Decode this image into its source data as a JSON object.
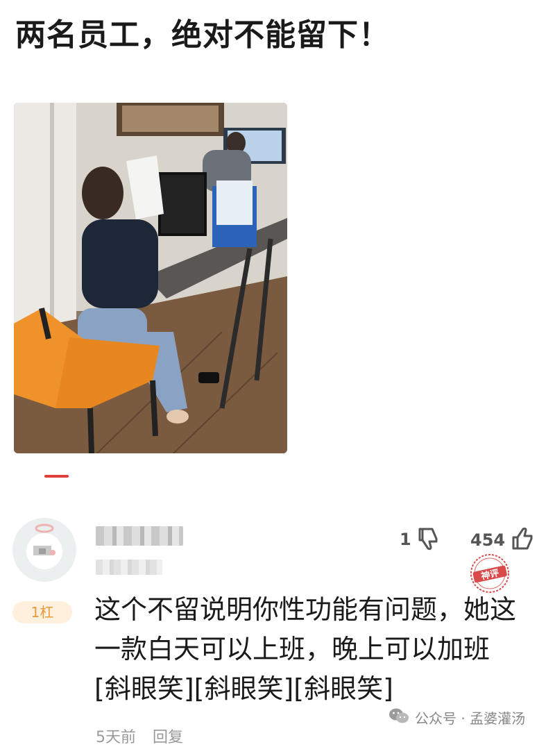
{
  "post": {
    "title": "两名员工，绝对不能留下！"
  },
  "comment": {
    "floor_badge": "1杠",
    "dislike_count": "1",
    "like_count": "454",
    "award_badge": "神评",
    "text": "这个不留说明你性功能有问题，她这一款白天可以上班，晚上可以加班[斜眼笑][斜眼笑][斜眼笑]",
    "time": "5天前",
    "reply_label": "回复"
  },
  "watermark": {
    "text": "公众号 · 孟婆灌汤"
  },
  "colors": {
    "accent": "#e0403a",
    "badge_bg": "#fff0de",
    "badge_text": "#e59a3c"
  }
}
